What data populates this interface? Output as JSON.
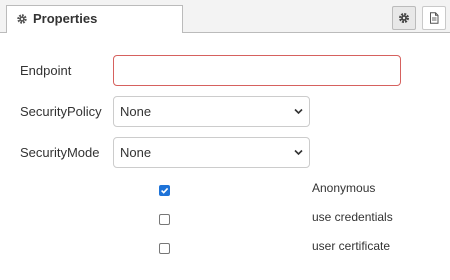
{
  "tabs": [
    {
      "label": "Properties",
      "icon": "gear-icon",
      "active": true
    }
  ],
  "toolbar": {
    "settings_icon": "gear-icon",
    "description_icon": "document-icon"
  },
  "form": {
    "endpoint": {
      "label": "Endpoint",
      "value": "",
      "placeholder": ""
    },
    "security_policy": {
      "label": "SecurityPolicy",
      "selected": "None"
    },
    "security_mode": {
      "label": "SecurityMode",
      "selected": "None"
    }
  },
  "auth_options": [
    {
      "label": "Anonymous",
      "checked": true
    },
    {
      "label": "use credentials",
      "checked": false
    },
    {
      "label": "user certificate",
      "checked": false
    }
  ],
  "colors": {
    "error_border": "#d6615e",
    "checkbox_checked": "#1e73d8"
  }
}
